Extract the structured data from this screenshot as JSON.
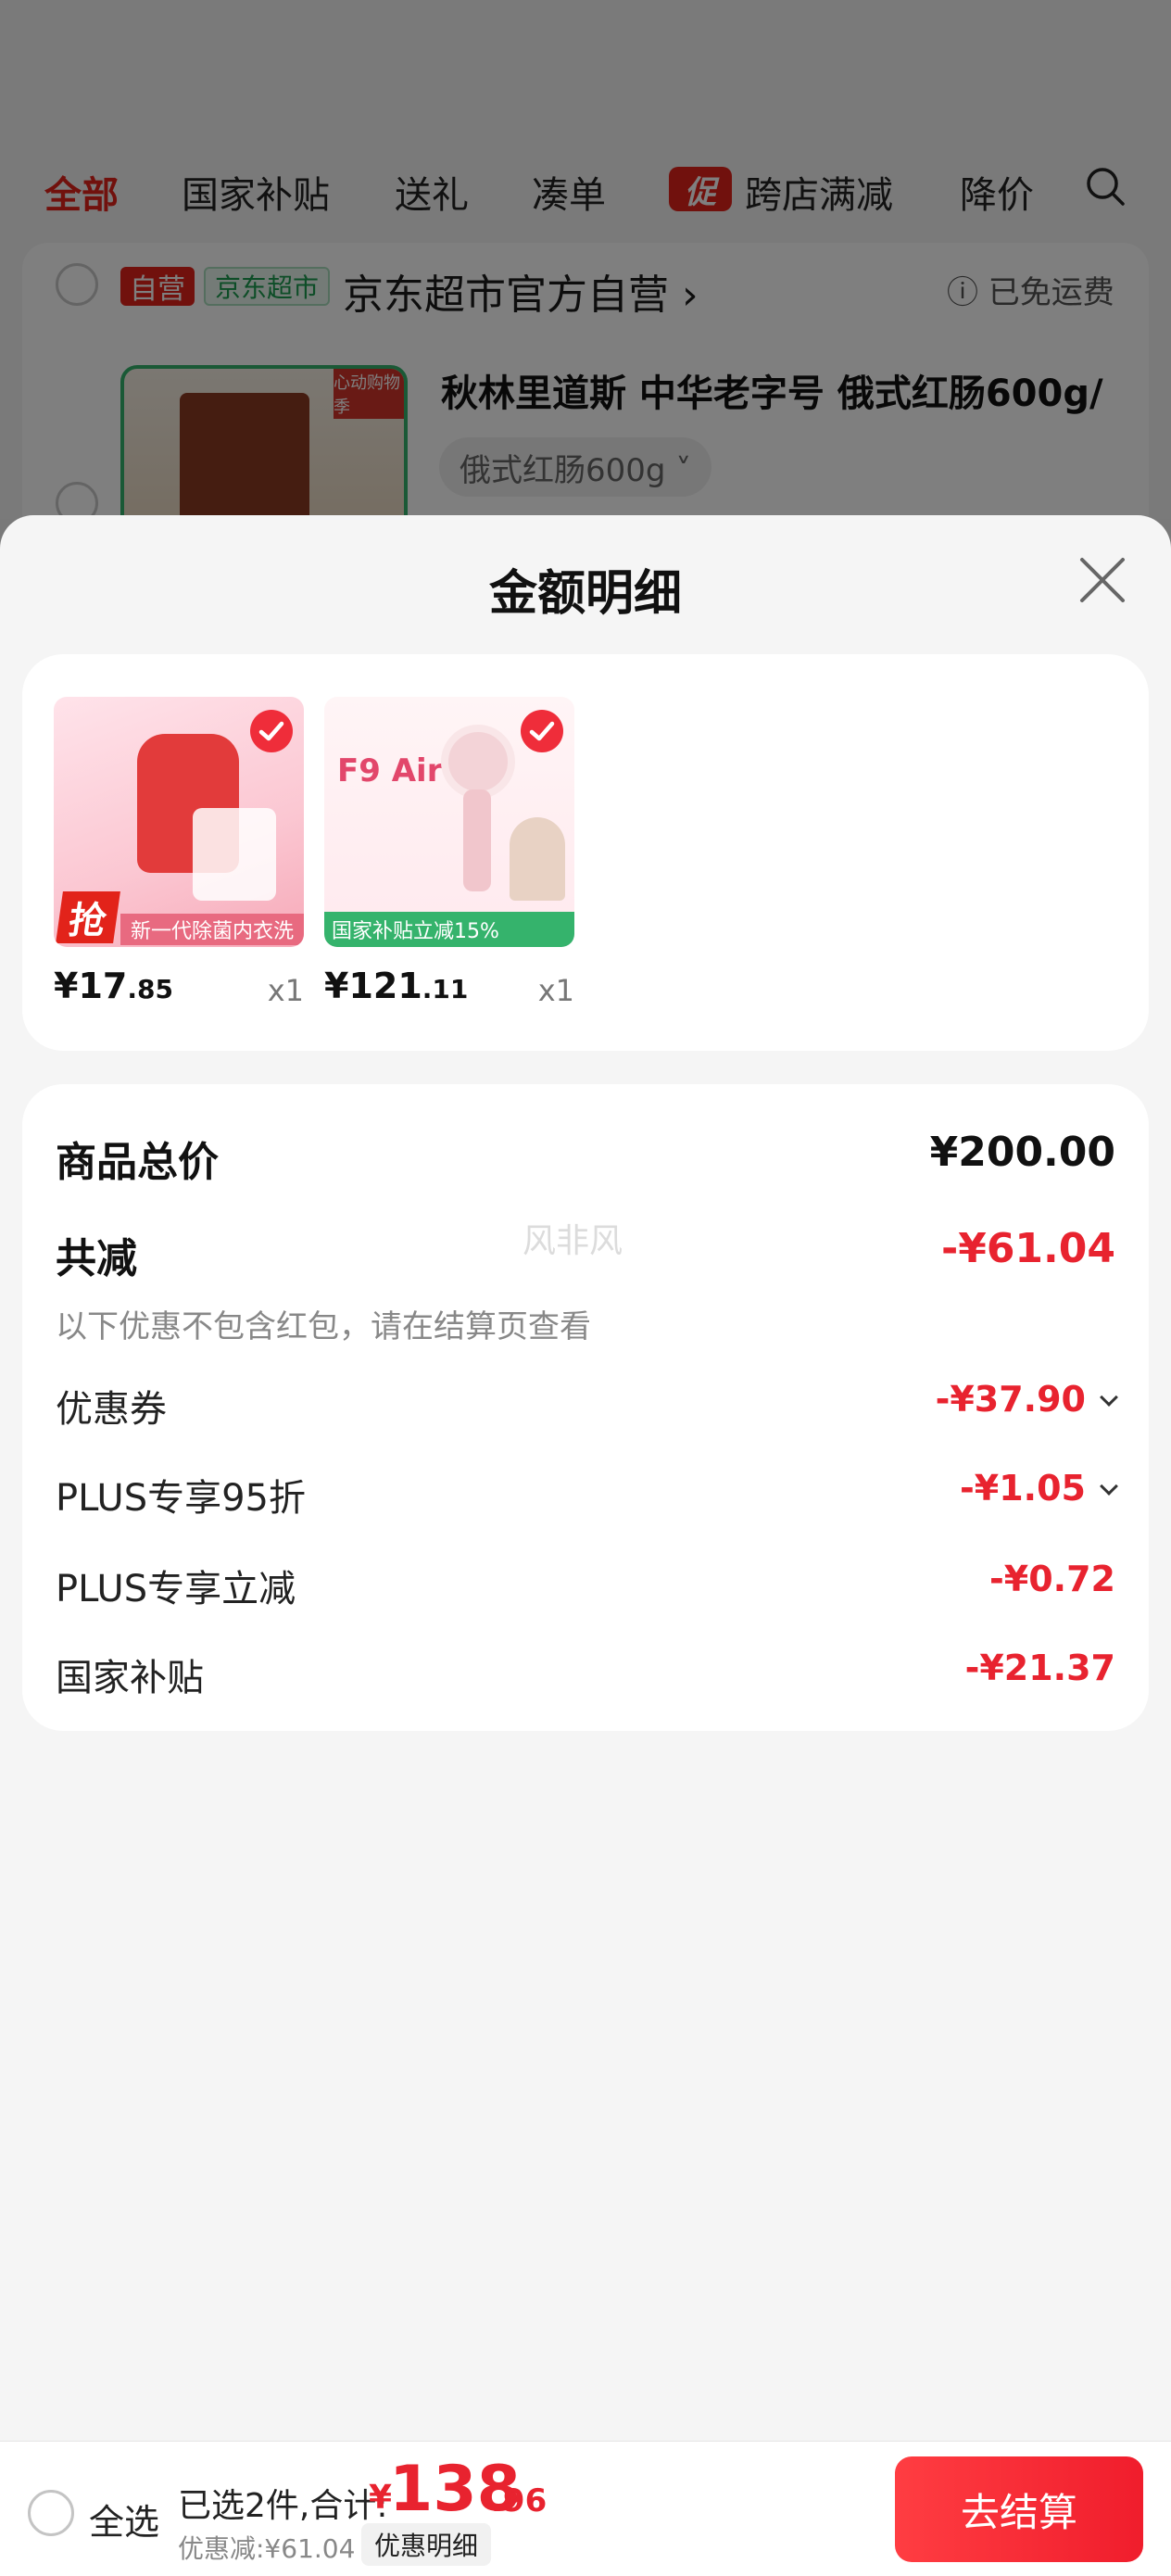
{
  "tabs": {
    "all": "全部",
    "subsidy": "国家补贴",
    "gift": "送礼",
    "bundle": "凑单",
    "promo_tag": "促",
    "cross_store": "跨店满减",
    "price_drop": "降价"
  },
  "store": {
    "self_badge": "自营",
    "jd_badge": "京东超市",
    "name": "京东超市官方自营 ›",
    "shipping": "ⓘ 已免运费"
  },
  "background_product": {
    "title": "秋林里道斯 中华老字号 俄式红肠600g/",
    "spec": "俄式红肠600g ˅",
    "thumb_tag": "心动购物季"
  },
  "sheet": {
    "title": "金额明细",
    "items": [
      {
        "price_int": "¥17",
        "price_dec": ".85",
        "qty": "x1",
        "img_text": "抢",
        "img_caption": "新一代除菌内衣洗"
      },
      {
        "price_int": "¥121",
        "price_dec": ".11",
        "qty": "x1",
        "img_text": "F9 Air",
        "img_caption": "国家补贴立减15%"
      }
    ],
    "summary": {
      "total_label": "商品总价",
      "total_value": "¥200.00",
      "reduce_label": "共减",
      "reduce_value": "-¥61.04",
      "note": "以下优惠不包含红包，请在结算页查看",
      "watermark": "风非风",
      "lines": [
        {
          "label": "优惠券",
          "value": "-¥37.90"
        },
        {
          "label": "PLUS专享95折",
          "value": "-¥1.05"
        },
        {
          "label": "PLUS专享立减",
          "value": "-¥0.72"
        },
        {
          "label": "国家补贴",
          "value": "-¥21.37"
        }
      ]
    }
  },
  "bottom": {
    "select_all": "全选",
    "selected": "已选2件,合计:",
    "yen": "¥",
    "total_int": "138",
    "total_dec": ".96",
    "discount": "优惠减:¥61.04",
    "detail_button": "优惠明细",
    "checkout": "去结算"
  },
  "colors": {
    "accent_red": "#e8232f",
    "jd_green": "#1b9a4e"
  }
}
